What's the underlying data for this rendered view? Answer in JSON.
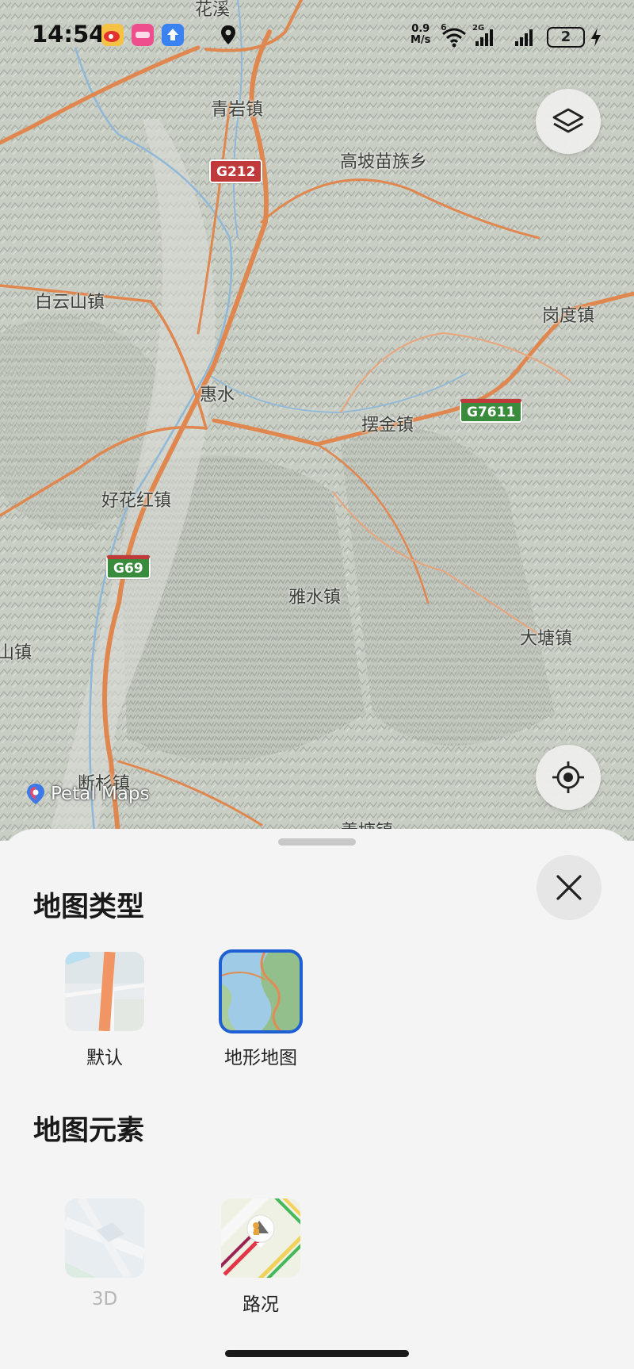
{
  "status_bar": {
    "time": "14:54",
    "net_speed_top": "0.9",
    "net_speed_bottom": "M/s",
    "wifi_badge": "6",
    "cell1_tag": "2G",
    "battery": "2"
  },
  "map": {
    "places": {
      "huaxi": "花溪",
      "qingyan": "青岩镇",
      "gaopo": "高坡苗族乡",
      "baiyunshan": "白云山镇",
      "gangdu": "岗度镇",
      "huishui": "惠水",
      "baijin": "摆金镇",
      "haohuahong": "好花红镇",
      "yashui": "雅水镇",
      "datang": "大塘镇",
      "shan_left": "山镇",
      "duanshan": "断杉镇",
      "xiantang": "羡塘镇"
    },
    "shields": {
      "g212": "G212",
      "g7611": "G7611",
      "g69": "G69"
    },
    "brand": "Petal Maps",
    "colors": {
      "road": "#e0874f",
      "river": "#8fb8d8",
      "terrain": "#c9cec5"
    }
  },
  "sheet": {
    "map_type_title": "地图类型",
    "map_types": [
      {
        "label": "默认",
        "selected": false
      },
      {
        "label": "地形地图",
        "selected": true
      }
    ],
    "map_elements_title": "地图元素",
    "map_elements": [
      {
        "label": "3D",
        "enabled": false
      },
      {
        "label": "路况",
        "enabled": true
      }
    ],
    "accent": "#1e5fd3"
  }
}
